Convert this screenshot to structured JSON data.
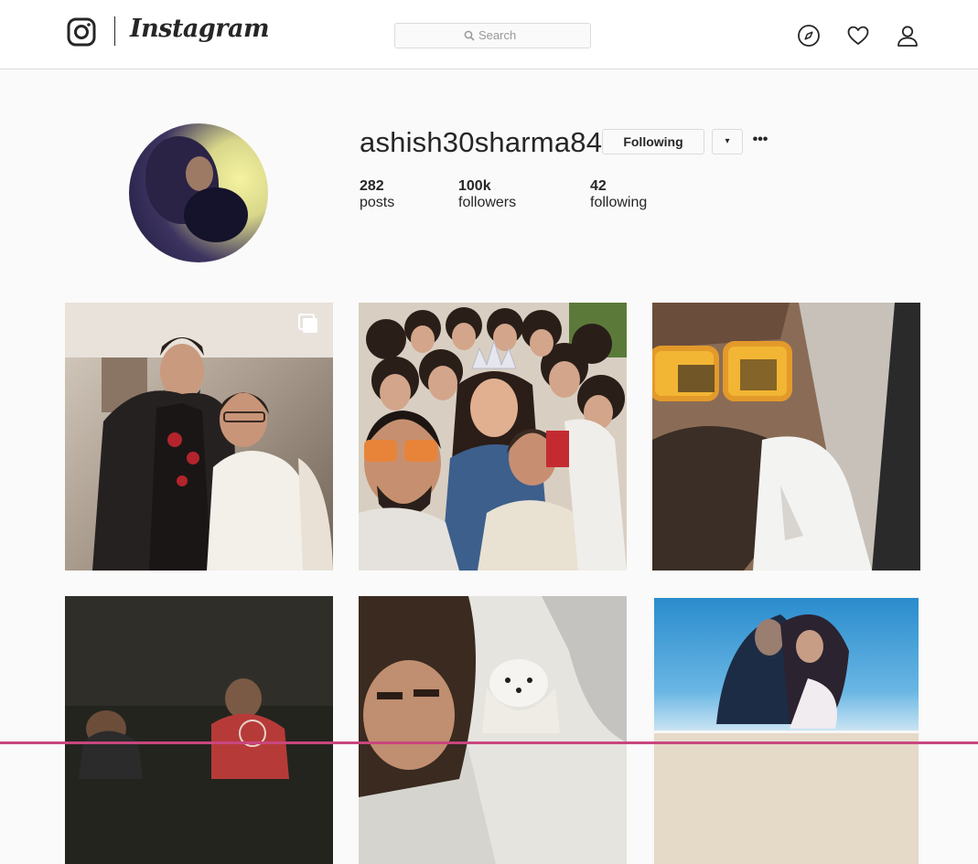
{
  "app": {
    "brand": "Instagram"
  },
  "search": {
    "placeholder": "Search"
  },
  "nav": {
    "icons": [
      "compass-icon",
      "heart-icon",
      "user-icon"
    ]
  },
  "profile": {
    "username": "ashish30sharma84",
    "follow_state": "Following",
    "dropdown_glyph": "▾",
    "more_glyph": "•••",
    "stats": {
      "posts_count": "282",
      "posts_label": "posts",
      "followers_count": "100k",
      "followers_label": "followers",
      "following_count": "42",
      "following_label": "following"
    }
  },
  "grid": {
    "posts": [
      {
        "kind": "carousel"
      },
      {
        "kind": "photo"
      },
      {
        "kind": "photo"
      },
      {
        "kind": "photo"
      },
      {
        "kind": "photo"
      },
      {
        "kind": "photo"
      }
    ]
  },
  "colors": {
    "topbar_bg": "#ffffff",
    "page_bg": "#fafafa",
    "border": "#dbdbdb",
    "text": "#262626",
    "muted": "#999999"
  }
}
